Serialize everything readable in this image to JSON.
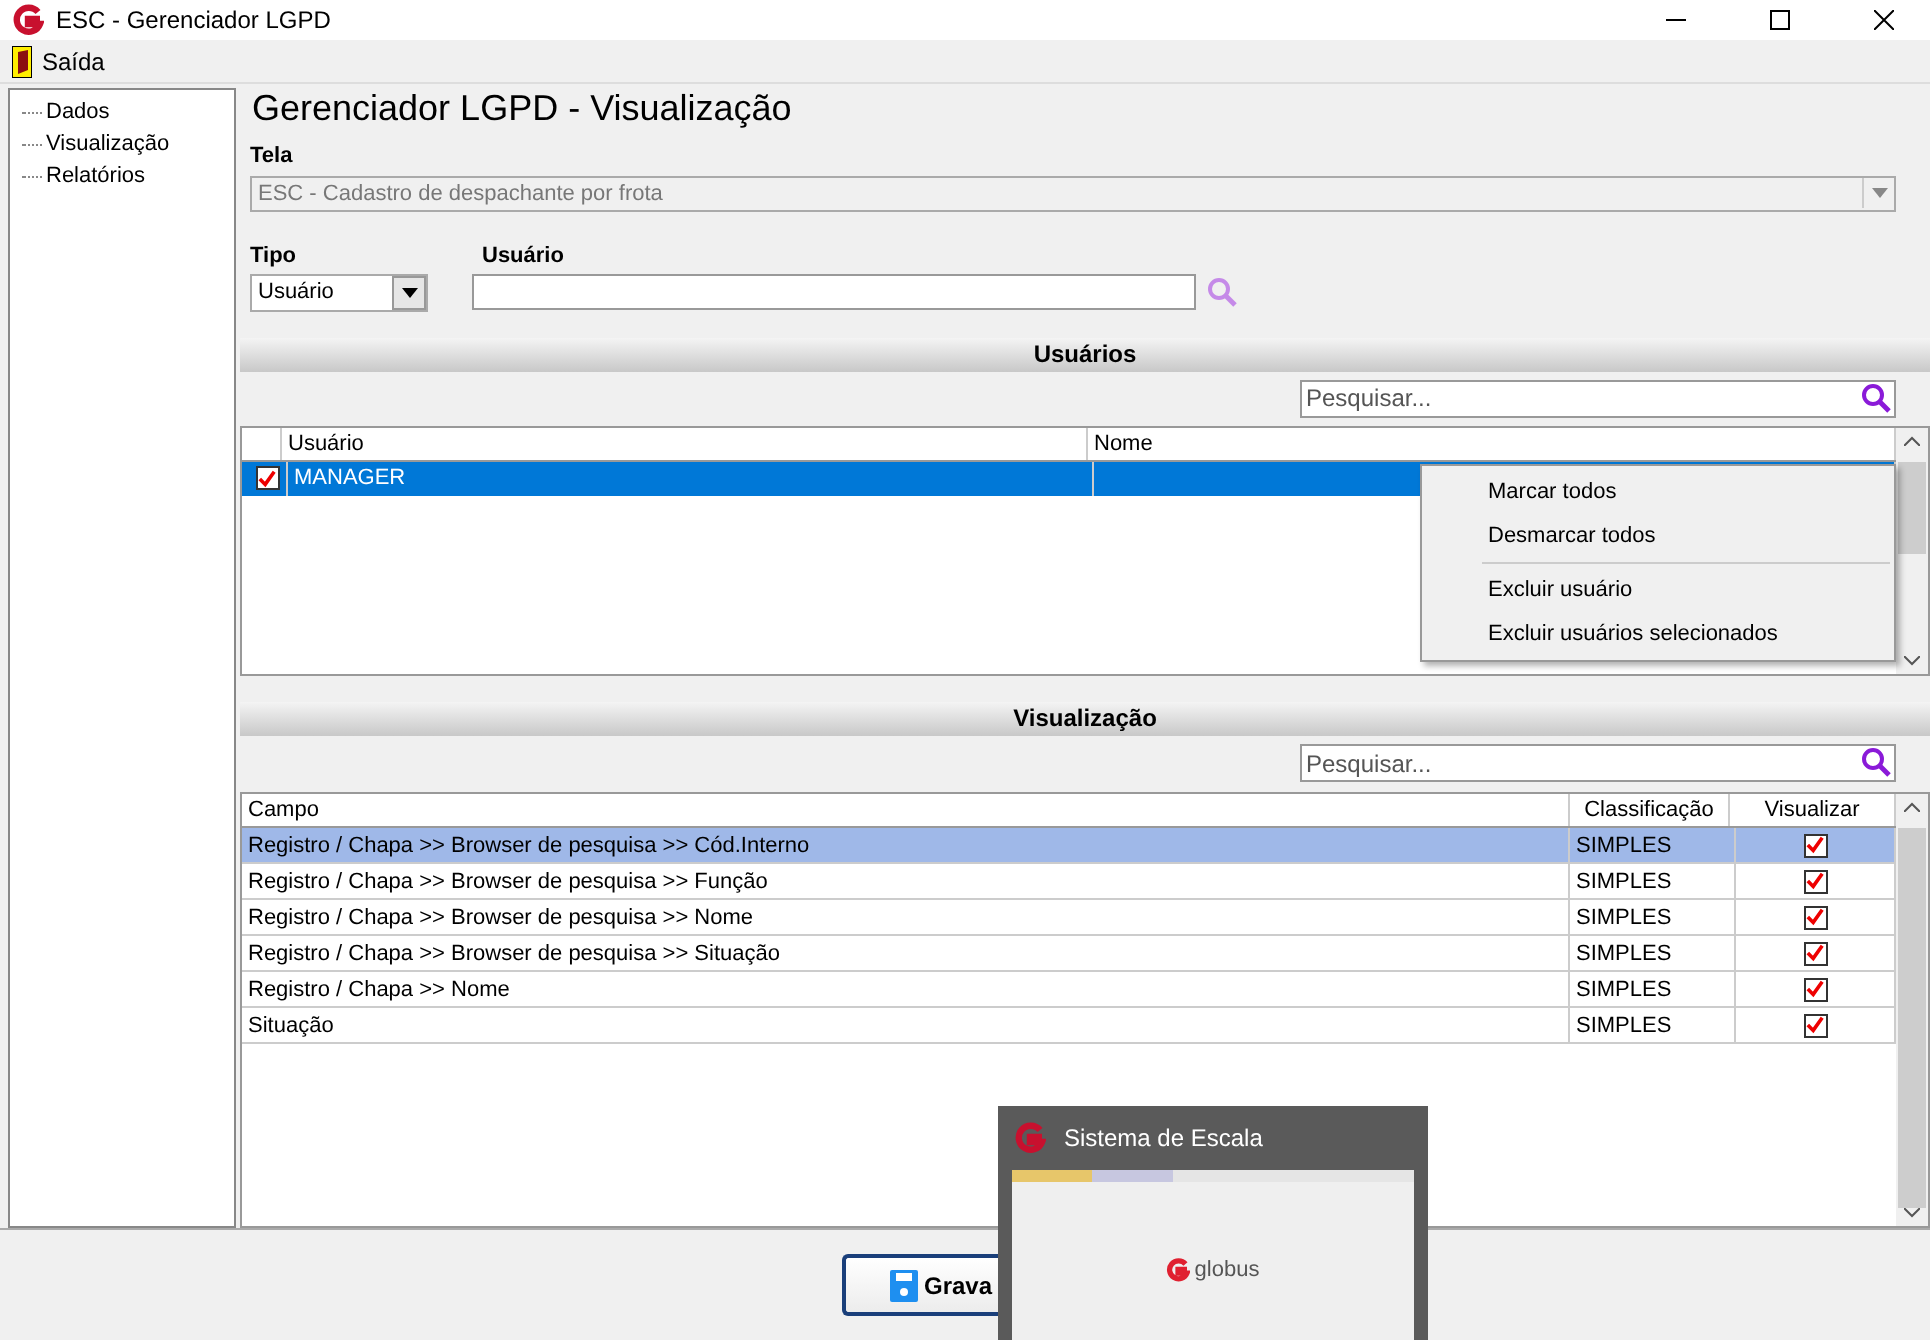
{
  "window": {
    "title": "ESC - Gerenciador LGPD"
  },
  "menu": [
    {
      "label": "Saída"
    }
  ],
  "tree": {
    "items": [
      {
        "label": "Dados"
      },
      {
        "label": "Visualização"
      },
      {
        "label": "Relatórios"
      }
    ]
  },
  "heading": "Gerenciador LGPD - Visualização",
  "tela": {
    "label": "Tela",
    "value": "ESC - Cadastro de despachante por frota",
    "disabled": true
  },
  "tipo": {
    "label": "Tipo",
    "value": "Usuário"
  },
  "usuario": {
    "label": "Usuário"
  },
  "users": {
    "title": "Usuários",
    "search": {
      "placeholder": "Pesquisar..."
    },
    "columns": [
      "Usuário",
      "Nome"
    ],
    "rows": [
      {
        "usuario": "MANAGER",
        "checked": true,
        "selected": true
      }
    ]
  },
  "context_menu": {
    "groups": [
      [
        "Marcar todos",
        "Desmarcar todos"
      ],
      [
        "Excluir usuário",
        "Excluir usuários selecionados"
      ]
    ]
  },
  "visualizacao": {
    "title": "Visualização",
    "search": {
      "placeholder": "Pesquisar..."
    },
    "columns": [
      "Campo",
      "Classificação",
      "Visualizar"
    ],
    "rows": [
      {
        "campo": "Registro / Chapa >> Browser de pesquisa >> Cód.Interno",
        "classificacao": "SIMPLES",
        "visualizar": true,
        "selected": true
      },
      {
        "campo": "Registro / Chapa >> Browser de pesquisa >> Função",
        "classificacao": "SIMPLES",
        "visualizar": true,
        "selected": false
      },
      {
        "campo": "Registro / Chapa >> Browser de pesquisa >> Nome",
        "classificacao": "SIMPLES",
        "visualizar": true,
        "selected": false
      },
      {
        "campo": "Registro / Chapa >> Browser de pesquisa >> Situação",
        "classificacao": "SIMPLES",
        "visualizar": true,
        "selected": false
      },
      {
        "campo": "Registro / Chapa >> Nome",
        "classificacao": "SIMPLES",
        "visualizar": true,
        "selected": false
      },
      {
        "campo": "Situação",
        "classificacao": "SIMPLES",
        "visualizar": true,
        "selected": false
      }
    ]
  },
  "save_button": {
    "label": "Grava"
  },
  "taskbar_preview": {
    "title": "Sistema de Escala",
    "thumbnail_text": "globus"
  }
}
